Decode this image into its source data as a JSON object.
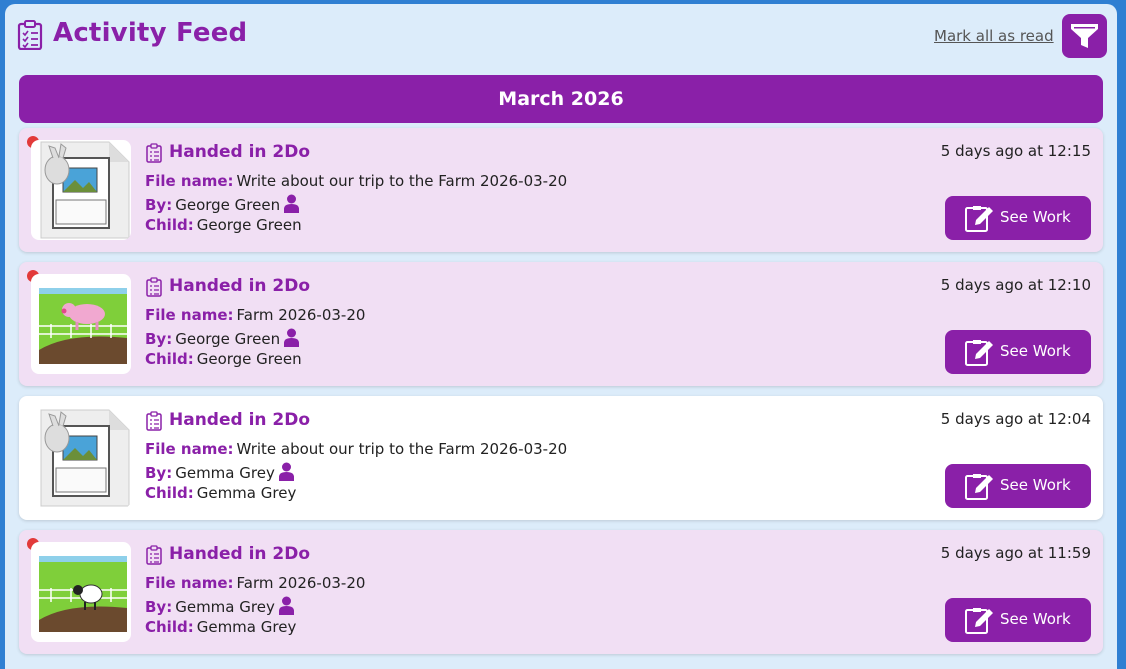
{
  "header": {
    "title": "Activity Feed",
    "mark_all_read": "Mark all as read",
    "icons": {
      "header": "clipboard-list-icon",
      "filter": "filter-icon"
    }
  },
  "month_label": "March 2026",
  "labels": {
    "file_name": "File name:",
    "by": "By:",
    "child": "Child:",
    "see_work": "See Work"
  },
  "colors": {
    "accent": "#8a20a8",
    "unread_bg": "#f1dff4",
    "read_bg": "#ffffff",
    "unread_dot": "#e23a3a",
    "panel_bg": "#dcecfa"
  },
  "items": [
    {
      "title": "Handed in 2Do",
      "time": "5 days ago at 12:15",
      "file_name": "Write about our trip to the Farm 2026-03-20",
      "by": "George Green",
      "child": "George Green",
      "unread": true,
      "thumbnail": "document-thumbnail"
    },
    {
      "title": "Handed in 2Do",
      "time": "5 days ago at 12:10",
      "file_name": "Farm 2026-03-20",
      "by": "George Green",
      "child": "George Green",
      "unread": true,
      "thumbnail": "pig-farm-picture"
    },
    {
      "title": "Handed in 2Do",
      "time": "5 days ago at 12:04",
      "file_name": "Write about our trip to the Farm 2026-03-20",
      "by": "Gemma Grey",
      "child": "Gemma Grey",
      "unread": false,
      "thumbnail": "document-thumbnail"
    },
    {
      "title": "Handed in 2Do",
      "time": "5 days ago at 11:59",
      "file_name": "Farm 2026-03-20",
      "by": "Gemma Grey",
      "child": "Gemma Grey",
      "unread": true,
      "thumbnail": "sheep-farm-picture"
    }
  ]
}
